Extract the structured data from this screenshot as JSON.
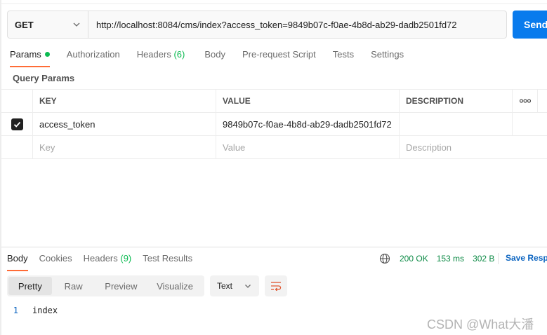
{
  "request": {
    "method": "GET",
    "url": "http://localhost:8084/cms/index?access_token=9849b07c-f0ae-4b8d-ab29-dadb2501fd72",
    "send_label": "Send"
  },
  "request_tabs": [
    {
      "label": "Params",
      "active": true,
      "count": ""
    },
    {
      "label": "Authorization",
      "active": false,
      "count": ""
    },
    {
      "label": "Headers",
      "active": false,
      "count": "(6)"
    },
    {
      "label": "Body",
      "active": false,
      "count": ""
    },
    {
      "label": "Pre-request Script",
      "active": false,
      "count": ""
    },
    {
      "label": "Tests",
      "active": false,
      "count": ""
    },
    {
      "label": "Settings",
      "active": false,
      "count": ""
    }
  ],
  "query_params": {
    "title": "Query Params",
    "columns": {
      "key": "KEY",
      "value": "VALUE",
      "description": "DESCRIPTION"
    },
    "rows": [
      {
        "checked": true,
        "key": "access_token",
        "value": "9849b07c-f0ae-4b8d-ab29-dadb2501fd72",
        "description": ""
      }
    ],
    "placeholder": {
      "key": "Key",
      "value": "Value",
      "description": "Description"
    }
  },
  "response_tabs": [
    {
      "label": "Body",
      "active": true,
      "count": ""
    },
    {
      "label": "Cookies",
      "active": false,
      "count": ""
    },
    {
      "label": "Headers",
      "active": false,
      "count": "(9)"
    },
    {
      "label": "Test Results",
      "active": false,
      "count": ""
    }
  ],
  "response_meta": {
    "status": "200 OK",
    "time": "153 ms",
    "size": "302 B",
    "save_label": "Save Resp"
  },
  "view_modes": [
    "Pretty",
    "Raw",
    "Preview",
    "Visualize"
  ],
  "active_view_mode": "Pretty",
  "format": "Text",
  "response_body": {
    "line_number": "1",
    "text": "index"
  },
  "watermark": "CSDN @What大潘",
  "colors": {
    "send": "#097bed",
    "active_tab_underline": "#ff6c37",
    "status_green": "#0cbb52"
  }
}
